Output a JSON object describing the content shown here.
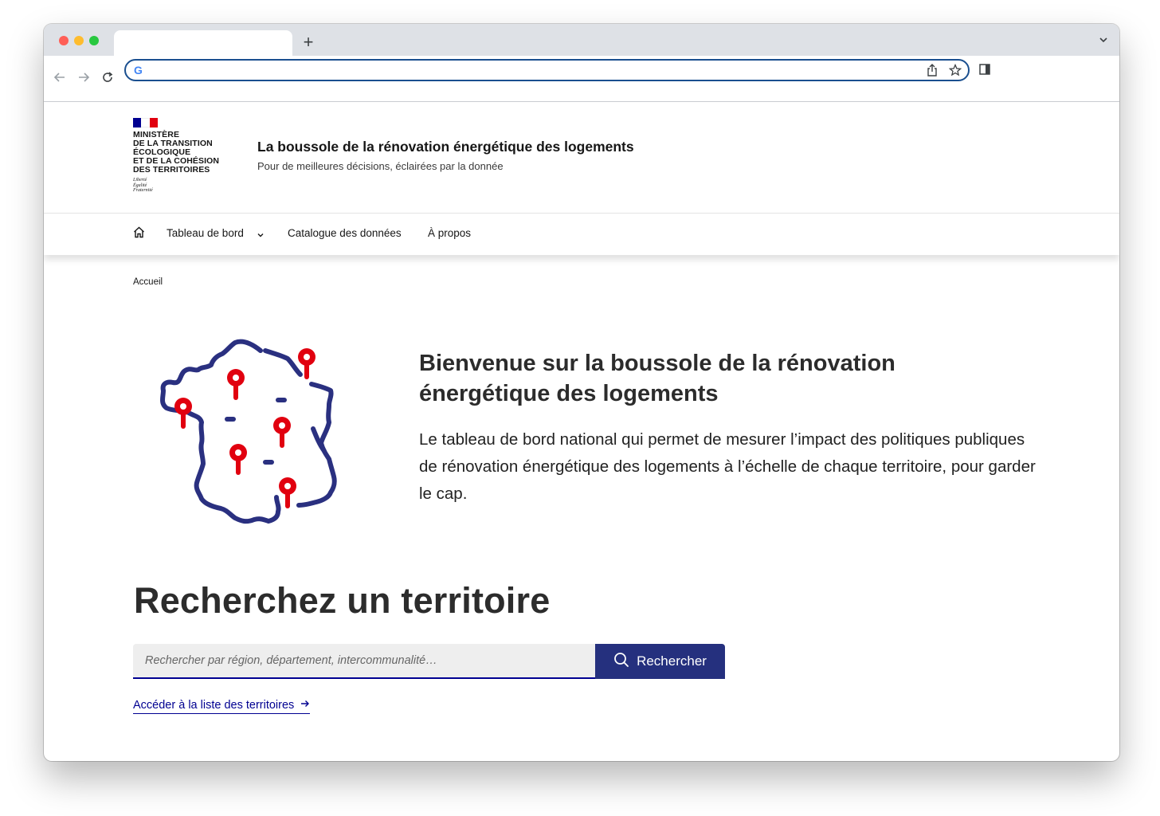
{
  "browser": {
    "tab_title": "",
    "new_tab_label": "+",
    "address": ""
  },
  "header": {
    "ministry_lines": [
      "MINISTÈRE",
      "DE LA TRANSITION",
      "ÉCOLOGIQUE",
      "ET DE LA COHÉSION",
      "DES TERRITOIRES"
    ],
    "motto": [
      "Liberté",
      "Égalité",
      "Fraternité"
    ],
    "service_title": "La boussole de la rénovation énergétique des logements",
    "service_tagline": "Pour de meilleures décisions, éclairées par la donnée"
  },
  "nav": {
    "items": [
      {
        "label": "Tableau de bord",
        "has_dropdown": true
      },
      {
        "label": "Catalogue des données"
      },
      {
        "label": "À propos"
      }
    ]
  },
  "breadcrumb": {
    "current": "Accueil"
  },
  "hero": {
    "title": "Bienvenue sur la boussole de la rénovation énergétique des logements",
    "text": "Le tableau de bord national qui permet de mesurer l’impact des politiques publiques de rénovation énergétique des logements à l’échelle de chaque territoire, pour garder le cap."
  },
  "search": {
    "title": "Recherchez un territoire",
    "placeholder": "Rechercher par région, département, intercommunalité…",
    "button_label": "Rechercher",
    "list_link": "Accéder à la liste des territoires"
  },
  "colors": {
    "brand_blue": "#000091",
    "button_blue": "#25307e",
    "map_outline": "#2a3080",
    "pin_red": "#e1000f"
  }
}
